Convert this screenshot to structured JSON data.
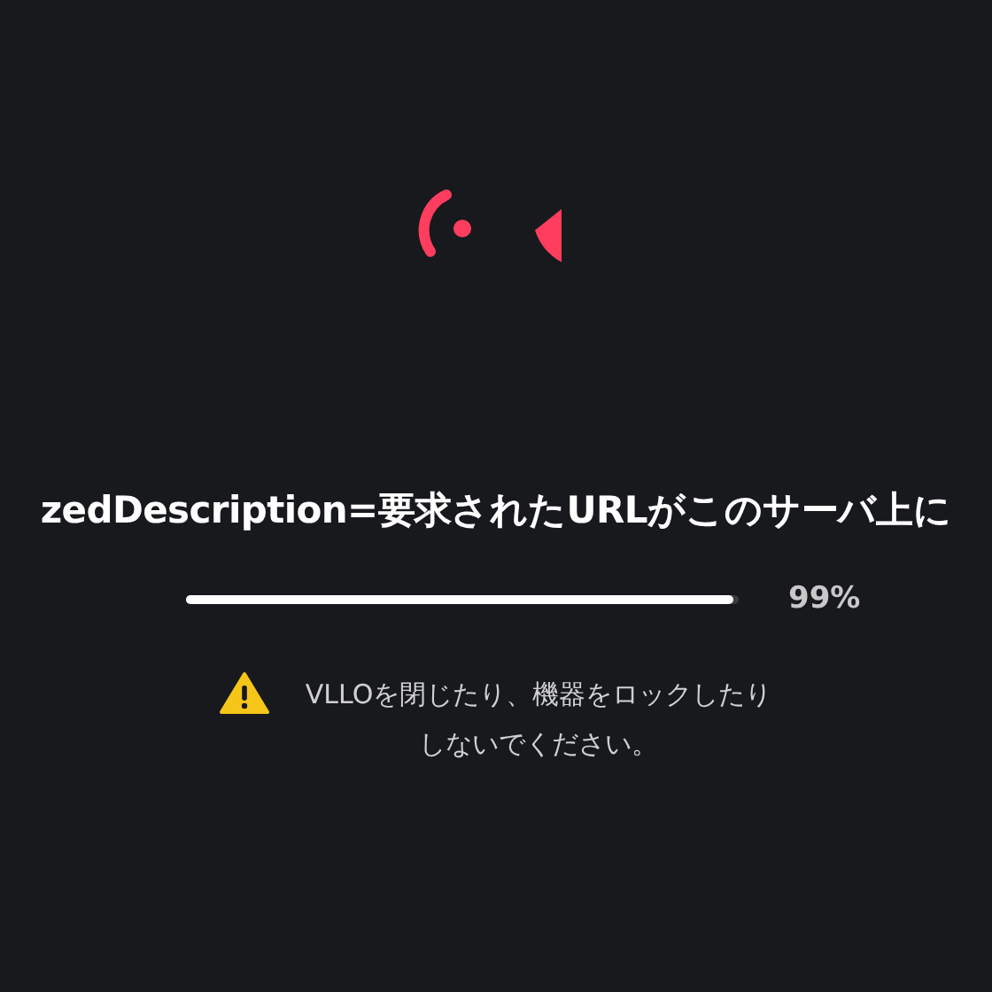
{
  "message": "zedDescription=要求されたURLがこのサーバ上に",
  "progress": {
    "level": 0.99,
    "reading": "99%"
  },
  "warning": {
    "lines": [
      "VLLOを閉じたり、機器をロックしたり",
      "しないでください。"
    ]
  }
}
